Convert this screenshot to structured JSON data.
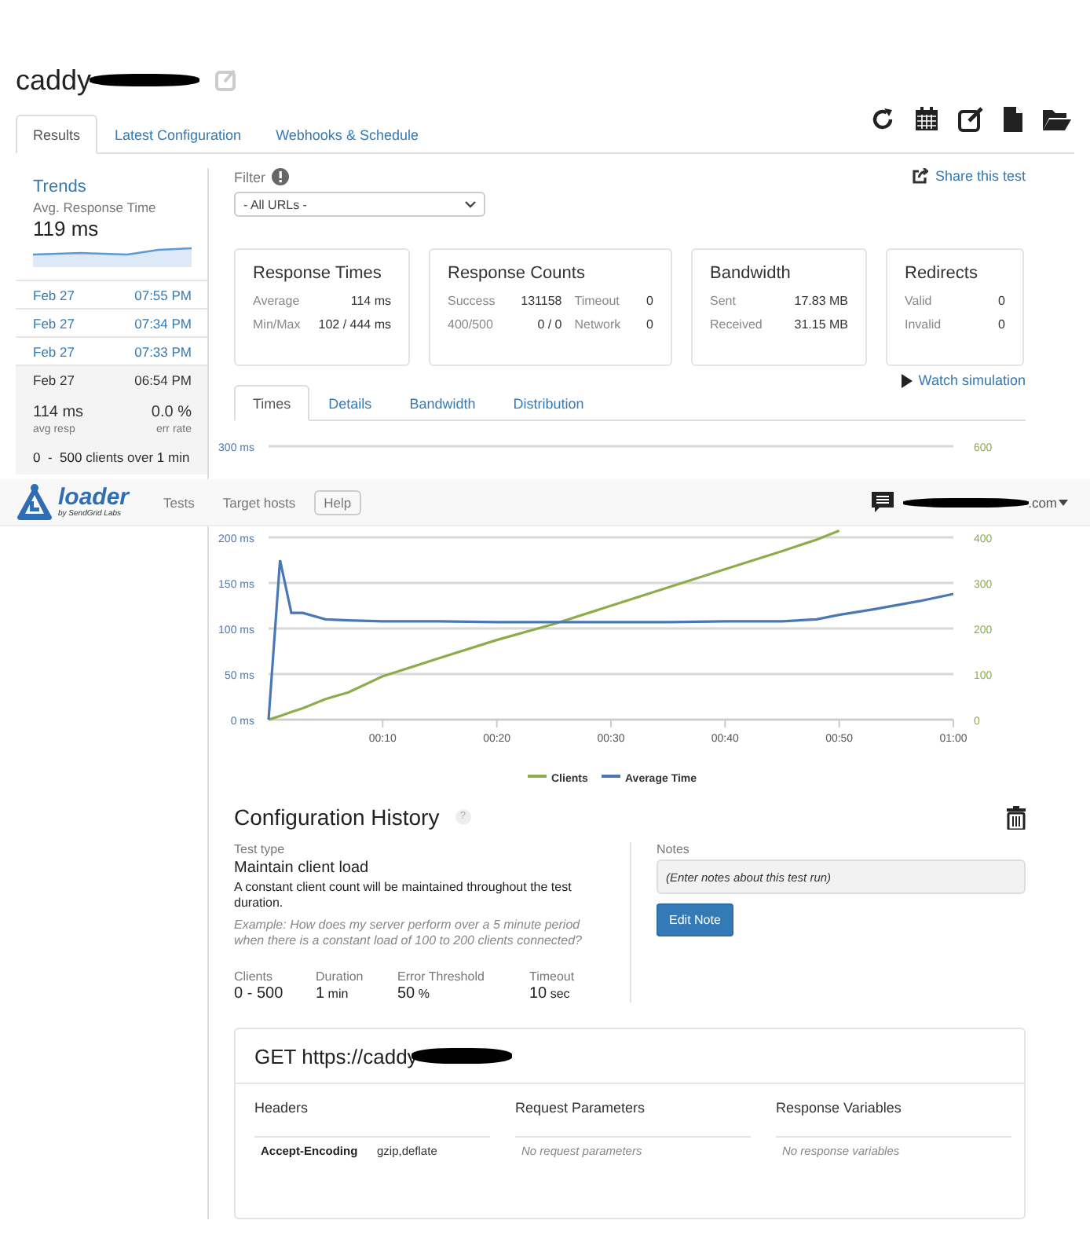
{
  "header": {
    "title": "caddy"
  },
  "tabs": [
    {
      "label": "Results",
      "selected": true
    },
    {
      "label": "Latest Configuration",
      "selected": false
    },
    {
      "label": "Webhooks & Schedule",
      "selected": false
    }
  ],
  "sidebar": {
    "title": "Trends",
    "metric_label": "Avg. Response Time",
    "metric_value": "119 ms",
    "runs": [
      {
        "date": "Feb 27",
        "time": "07:55 PM",
        "selected": false
      },
      {
        "date": "Feb 27",
        "time": "07:34 PM",
        "selected": false
      },
      {
        "date": "Feb 27",
        "time": "07:33 PM",
        "selected": false
      },
      {
        "date": "Feb 27",
        "time": "06:54 PM",
        "selected": true,
        "avg": "114 ms",
        "avg_label": "avg resp",
        "err": "0.0 %",
        "err_label": "err rate",
        "summary": "**0**  -  **500** clients over **1** min"
      }
    ]
  },
  "filter": {
    "label": "Filter",
    "value": "- All URLs -"
  },
  "share": "Share this test",
  "cards": [
    {
      "title": "Response Times",
      "rows": [
        [
          "Average",
          "114 ms"
        ],
        [
          "Min/Max",
          "102 / 444 ms"
        ]
      ]
    },
    {
      "title": "Response Counts",
      "rows": [
        [
          "Success",
          "131158",
          "Timeout",
          "0"
        ],
        [
          "400/500",
          "0 / 0",
          "Network",
          "0"
        ]
      ]
    },
    {
      "title": "Bandwidth",
      "rows": [
        [
          "Sent",
          "17.83 MB"
        ],
        [
          "Received",
          "31.15 MB"
        ]
      ]
    },
    {
      "title": "Redirects",
      "rows": [
        [
          "Valid",
          "0"
        ],
        [
          "Invalid",
          "0"
        ]
      ]
    }
  ],
  "subtabs": [
    {
      "label": "Times",
      "selected": true
    },
    {
      "label": "Details",
      "selected": false
    },
    {
      "label": "Bandwidth",
      "selected": false
    },
    {
      "label": "Distribution",
      "selected": false
    }
  ],
  "watch": "Watch simulation",
  "chart_data": {
    "type": "line",
    "x": [
      0,
      1,
      2,
      3,
      5,
      7,
      10,
      15,
      20,
      25,
      30,
      35,
      40,
      45,
      48,
      50,
      53,
      57,
      60
    ],
    "xlim": [
      0,
      60
    ],
    "xticks": [
      {
        "value": 10,
        "label": "00:10"
      },
      {
        "value": 20,
        "label": "00:20"
      },
      {
        "value": 30,
        "label": "00:30"
      },
      {
        "value": 40,
        "label": "00:40"
      },
      {
        "value": 50,
        "label": "00:50"
      },
      {
        "value": 60,
        "label": "01:00"
      }
    ],
    "ylim": [
      0,
      300
    ],
    "yticks": [
      {
        "value": 0,
        "label": "0 ms"
      },
      {
        "value": 50,
        "label": "50 ms"
      },
      {
        "value": 100,
        "label": "100 ms"
      },
      {
        "value": 150,
        "label": "150 ms"
      },
      {
        "value": 200,
        "label": "200 ms"
      },
      {
        "value": 300,
        "label": "300 ms"
      }
    ],
    "grid": true,
    "legend": true,
    "y2lim": [
      0,
      600
    ],
    "y2ticks": [
      {
        "value": 0,
        "label": "0"
      },
      {
        "value": 100,
        "label": "100"
      },
      {
        "value": 200,
        "label": "200"
      },
      {
        "value": 300,
        "label": "300"
      },
      {
        "value": 400,
        "label": "400"
      },
      {
        "value": 600,
        "label": "600"
      }
    ],
    "series": [
      {
        "name": "Clients",
        "color": "#8fac4c",
        "axis": "y2",
        "values": [
          0,
          8,
          17,
          25,
          45,
          60,
          95,
          135,
          175,
          210,
          250,
          290,
          330,
          370,
          395,
          415,
          null,
          null,
          null
        ]
      },
      {
        "name": "Average Time",
        "color": "#4a78b5",
        "values": [
          0,
          175,
          117,
          117,
          110,
          109,
          108,
          108,
          107,
          107,
          107,
          107,
          108,
          108,
          110,
          115,
          121,
          130,
          138
        ]
      }
    ]
  },
  "navbar": {
    "brand": "loader",
    "brand_sub": "by SendGrid Labs",
    "links": [
      {
        "label": "Tests",
        "kind": "link"
      },
      {
        "label": "Target hosts",
        "kind": "link"
      },
      {
        "label": "Help",
        "kind": "button"
      }
    ],
    "account": ".com"
  },
  "config": {
    "title": "Configuration History",
    "help": "?",
    "test_type_label": "Test type",
    "test_type": "Maintain client load",
    "description": "A constant client count will be maintained throughout the test duration.",
    "example": "Example: How does my server perform over a 5 minute period when there is a constant load of 100 to 200 clients connected?",
    "stats": [
      {
        "label": "Clients",
        "value": "0 - 500"
      },
      {
        "label": "Duration",
        "value": "1",
        "unit": "min"
      },
      {
        "label": "Error Threshold",
        "value": "50",
        "unit": "%"
      },
      {
        "label": "Timeout",
        "value": "10",
        "unit": "sec"
      }
    ],
    "notes_label": "Notes",
    "notes_placeholder": "(Enter notes about this test run)",
    "edit_button": "Edit Note"
  },
  "request": {
    "title": "GET https://caddy",
    "columns": [
      {
        "heading": "Headers",
        "rows": [
          {
            "name": "Accept-Encoding",
            "value": "gzip,deflate"
          }
        ]
      },
      {
        "heading": "Request Parameters",
        "empty": "No request parameters"
      },
      {
        "heading": "Response Variables",
        "empty": "No response variables"
      }
    ]
  }
}
